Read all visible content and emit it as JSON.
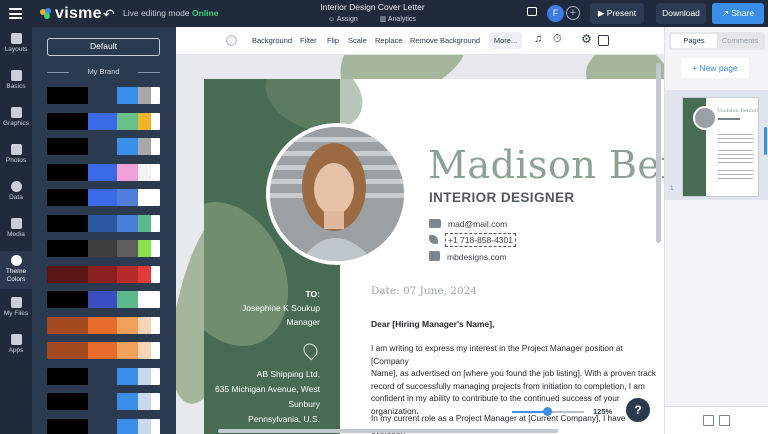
{
  "topbar": {
    "brand": "visme",
    "mode_label": "Live editing mode",
    "mode_status": "Online",
    "doc_title": "Interior Design Cover Letter",
    "assign": "Assign",
    "analytics": "Analytics",
    "avatar_initial": "F",
    "present": "Present",
    "download": "Download",
    "share": "Share"
  },
  "rail": [
    {
      "label": "Layouts",
      "icon": "layouts-icon"
    },
    {
      "label": "Basics",
      "icon": "basics-icon"
    },
    {
      "label": "Graphics",
      "icon": "graphics-icon"
    },
    {
      "label": "Photos",
      "icon": "photos-icon"
    },
    {
      "label": "Data",
      "icon": "data-icon"
    },
    {
      "label": "Media",
      "icon": "media-icon"
    },
    {
      "label": "Theme Colors",
      "icon": "palette-icon"
    },
    {
      "label": "My Files",
      "icon": "folder-icon"
    },
    {
      "label": "Apps",
      "icon": "apps-icon"
    }
  ],
  "panel": {
    "default_button": "Default",
    "my_brand": "My Brand",
    "palettes": [
      [
        "#000000",
        "#2c3a4f",
        "#3b8ee8",
        "#a8a8a8",
        "#ffffff"
      ],
      [
        "#000000",
        "#3b6ae8",
        "#6abf8a",
        "#f0b429",
        "#ffffff"
      ],
      [
        "#000000",
        "#2c3a4f",
        "#3b8ee8",
        "#a8a8a8",
        "#ffffff"
      ],
      [
        "#000000",
        "#3b6ae8",
        "#f2a0d8",
        "#f2f2f2",
        "#ffffff"
      ],
      [
        "#000000",
        "#3b6ae8",
        "#4f7fd9",
        "#ffffff",
        "#ffffff"
      ],
      [
        "#000000",
        "#2c5aa0",
        "#4a7fd8",
        "#5cb88a",
        "#ffffff"
      ],
      [
        "#000000",
        "#3d3d3d",
        "#5d5d5d",
        "#8be04e",
        "#ffffff"
      ],
      [
        "#5a1515",
        "#8b1e1e",
        "#b52b2b",
        "#e03a3a",
        "#ffffff"
      ],
      [
        "#000000",
        "#3b4fc2",
        "#5cb88a",
        "#ffffff",
        "#ffffff"
      ],
      [
        "#a34a1e",
        "#e86d2c",
        "#f2a05a",
        "#f5d5b5",
        "#ffffff"
      ],
      [
        "#a34a1e",
        "#e86d2c",
        "#f2a05a",
        "#f5d5b5",
        "#ffffff"
      ],
      [
        "#000000",
        "#2c3a4f",
        "#3b8ee8",
        "#c8d8ef",
        "#ffffff"
      ],
      [
        "#000000",
        "#2c3a4f",
        "#3b8ee8",
        "#c8d8ef",
        "#ffffff"
      ],
      [
        "#000000",
        "#2c3a4f",
        "#3b8ee8",
        "#c8d8ef",
        "#ffffff"
      ]
    ]
  },
  "toolbar": {
    "items": [
      "Background",
      "Filter",
      "Flip",
      "Scale",
      "Replace",
      "Remove Background"
    ],
    "more": "More..."
  },
  "document": {
    "name": "Madison Benne",
    "title": "INTERIOR DESIGNER",
    "email": "mad@mail.com",
    "phone": "+1 718-858-4301",
    "website": "mbdesigns.com",
    "date": "Date: 07 June, 2024",
    "to_label": "TO:",
    "to_name": "Josephine K Soukup",
    "to_role": "Manager",
    "company": "AB Shipping Ltd.",
    "street": "635 Michigan Avenue, West",
    "city": "Sunbury",
    "state": "Pennsylvania, U.S.",
    "salutation": "Dear [Hiring Manager's Name],",
    "para1_lines": [
      "I am writing to express my interest in the Project Manager position at [Company",
      "Name], as advertised on [where you found the job listing]. With a proven track",
      "record of successfully managing projects from initiation to completion, I am",
      "confident in my ability to contribute to the continued success of your",
      "organization."
    ],
    "para2_line": "In my current role as a Project Manager at [Current Company], I have overseen"
  },
  "zoom": {
    "label": "125%",
    "level": 0.48
  },
  "help": "?",
  "pages_panel": {
    "tab_pages": "Pages",
    "tab_comments": "Comments",
    "new_page": "+ New page",
    "page_number": "1",
    "thumb_name": "Madison Bennet"
  },
  "colors": {
    "topbar": "#1f2a3d",
    "panel": "#2c3a4f",
    "accent": "#3b8ee8",
    "green": "#476b53",
    "online": "#3ad37a"
  }
}
